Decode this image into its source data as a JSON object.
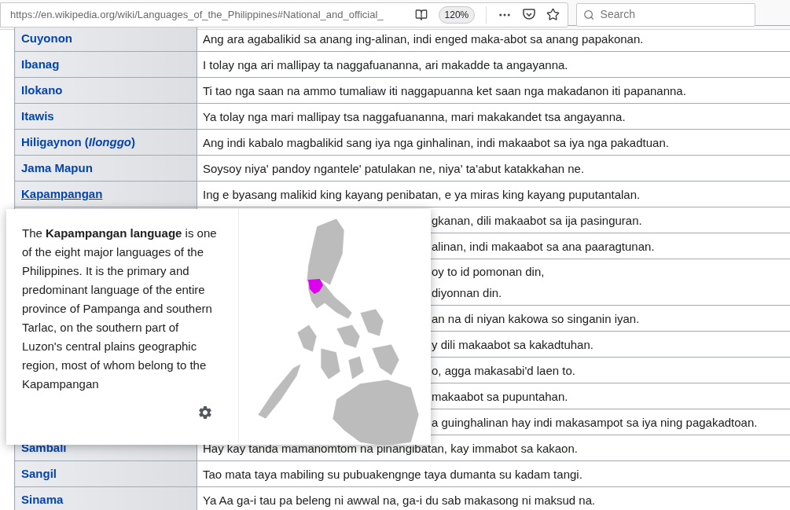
{
  "browser": {
    "url": "https://en.wikipedia.org/wiki/Languages_of_the_Philippines#National_and_official_",
    "zoom": "120%",
    "search": {
      "placeholder": "Search"
    }
  },
  "table": {
    "rows": [
      {
        "name": "Cuyonon",
        "lines": [
          "Ang ara agabalikid sa anang ing-alinan, indi enged maka-abot sa anang papakonan."
        ]
      },
      {
        "name": "Ibanag",
        "lines": [
          "I tolay nga ari mallipay ta naggafuananna, ari makadde ta angayanna."
        ]
      },
      {
        "name": "Ilokano",
        "lines": [
          "Ti tao nga saan na ammo tumaliaw iti naggapuanna ket saan nga makadanon iti papananna."
        ]
      },
      {
        "name": "Itawis",
        "lines": [
          "Ya tolay nga mari mallipay tsa naggafuananna, mari makakandet tsa angayanna."
        ]
      },
      {
        "name": "Hiligaynon (*Ilonggo*)",
        "lines": [
          "Ang indi kabalo magbalikid sang iya nga ginhalinan, indi makaabot sa iya nga pakadtuan."
        ]
      },
      {
        "name": "Jama Mapun",
        "lines": [
          "Soysoy niya' pandoy ngantele' patulakan ne, niya' ta'abut katakkahan ne."
        ]
      },
      {
        "name": "Kapampangan",
        "hovered": true,
        "lines": [
          "Ing e byasang malikid king kayang penibatan, e ya miras king kayang puputantalan."
        ]
      },
      {
        "lines": [
          "gkanan, dili makaabot sa ija pasinguran."
        ]
      },
      {
        "lines": [
          "alinan, indi makaabot sa ana paaragtunan."
        ]
      },
      {
        "lines": [
          "oy to id pomonan din,",
          "diyonnan din."
        ]
      },
      {
        "lines": [
          "an na di niyan kakowa so singanin iyan."
        ]
      },
      {
        "lines": [
          "y dili makaabot sa kakadtuhan."
        ]
      },
      {
        "lines": [
          "o, agga makasabi'd laen to."
        ]
      },
      {
        "lines": [
          "makaabot sa pupuntahan."
        ]
      },
      {
        "lines": [
          "a guinghalinan hay indi makasampot sa iya ning pagakadtoan."
        ]
      },
      {
        "name": "Sambali",
        "lines": [
          "Hay kay tanda mamanomtom na pinangibatan, kay immabot sa kakaon."
        ]
      },
      {
        "name": "Sangil",
        "lines": [
          "Tao mata taya mabiling su pubuakengnge taya dumanta su kadam tangi."
        ]
      },
      {
        "name": "Sinama",
        "lines": [
          "Ya Aa ga-i tau pa beleng ni awwal na, ga-i du sab makasong ni maksud na."
        ]
      }
    ]
  },
  "popup": {
    "extract": "The **Kapampangan language** is one of the eight major languages of the Philippines. It is the primary and predominant language of the entire province of Pampanga and southern Tarlac, on the southern part of Luzon's central plains geographic region, most of whom belong to the Kapampangan"
  }
}
